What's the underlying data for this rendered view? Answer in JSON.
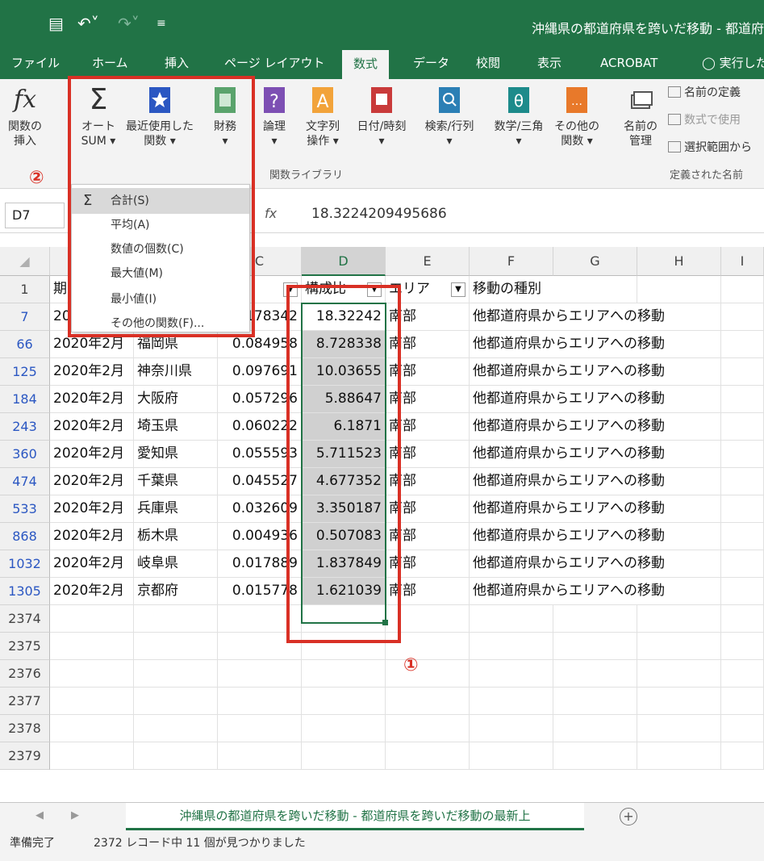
{
  "window": {
    "title": "沖縄県の都道府県を跨いだ移動 - 都道府"
  },
  "tabs": [
    "ファイル",
    "ホーム",
    "挿入",
    "ページ レイアウト",
    "数式",
    "データ",
    "校閲",
    "表示",
    "ACROBAT",
    "実行した"
  ],
  "ribbon": {
    "insert_fn": [
      "関数の",
      "挿入"
    ],
    "autosum": [
      "オート",
      "SUM ▾"
    ],
    "recent": [
      "最近使用した",
      "関数 ▾"
    ],
    "finance": [
      "財務",
      "▾"
    ],
    "logic": [
      "論理",
      "▾"
    ],
    "text": [
      "文字列",
      "操作 ▾"
    ],
    "datetime": [
      "日付/時刻",
      "▾"
    ],
    "lookup": [
      "検索/行列",
      "▾"
    ],
    "math": [
      "数学/三角",
      "▾"
    ],
    "other": [
      "その他の",
      "関数 ▾"
    ],
    "name_mgr": [
      "名前の",
      "管理"
    ],
    "define_name": "名前の定義",
    "use_formula": "数式で使用",
    "from_selection": "選択範囲から",
    "group_library": "関数ライブラリ",
    "group_names": "定義された名前"
  },
  "formula_bar": {
    "cell": "D7",
    "fx": "fx",
    "value": "18.3224209495686"
  },
  "dropdown": {
    "items": [
      "合計(S)",
      "平均(A)",
      "数値の個数(C)",
      "最大値(M)",
      "最小値(I)",
      "その他の関数(F)..."
    ]
  },
  "grid": {
    "columns": [
      "C",
      "D",
      "E",
      "F",
      "G",
      "H",
      "I"
    ],
    "header_row": {
      "num": "1",
      "a": "期",
      "d": "構成比",
      "e": "エリア",
      "f": "移動の種別"
    },
    "rows": [
      {
        "num": "7",
        "a": "20",
        "b": "",
        "c": "178342",
        "d": "18.32242",
        "e": "南部",
        "f": "他都道府県からエリアへの移動"
      },
      {
        "num": "66",
        "a": "2020年2月",
        "b": "福岡県",
        "c": "0.084958",
        "d": "8.728338",
        "e": "南部",
        "f": "他都道府県からエリアへの移動"
      },
      {
        "num": "125",
        "a": "2020年2月",
        "b": "神奈川県",
        "c": "0.097691",
        "d": "10.03655",
        "e": "南部",
        "f": "他都道府県からエリアへの移動"
      },
      {
        "num": "184",
        "a": "2020年2月",
        "b": "大阪府",
        "c": "0.057296",
        "d": "5.88647",
        "e": "南部",
        "f": "他都道府県からエリアへの移動"
      },
      {
        "num": "243",
        "a": "2020年2月",
        "b": "埼玉県",
        "c": "0.060222",
        "d": "6.1871",
        "e": "南部",
        "f": "他都道府県からエリアへの移動"
      },
      {
        "num": "360",
        "a": "2020年2月",
        "b": "愛知県",
        "c": "0.055593",
        "d": "5.711523",
        "e": "南部",
        "f": "他都道府県からエリアへの移動"
      },
      {
        "num": "474",
        "a": "2020年2月",
        "b": "千葉県",
        "c": "0.045527",
        "d": "4.677352",
        "e": "南部",
        "f": "他都道府県からエリアへの移動"
      },
      {
        "num": "533",
        "a": "2020年2月",
        "b": "兵庫県",
        "c": "0.032609",
        "d": "3.350187",
        "e": "南部",
        "f": "他都道府県からエリアへの移動"
      },
      {
        "num": "868",
        "a": "2020年2月",
        "b": "栃木県",
        "c": "0.004936",
        "d": "0.507083",
        "e": "南部",
        "f": "他都道府県からエリアへの移動"
      },
      {
        "num": "1032",
        "a": "2020年2月",
        "b": "岐阜県",
        "c": "0.017889",
        "d": "1.837849",
        "e": "南部",
        "f": "他都道府県からエリアへの移動"
      },
      {
        "num": "1305",
        "a": "2020年2月",
        "b": "京都府",
        "c": "0.015778",
        "d": "1.621039",
        "e": "南部",
        "f": "他都道府県からエリアへの移動"
      }
    ],
    "empty_rows": [
      "2374",
      "2375",
      "2376",
      "2377",
      "2378",
      "2379"
    ]
  },
  "annotations": {
    "one": "①",
    "two": "②"
  },
  "sheet": {
    "name": "沖縄県の都道府県を跨いだ移動 - 都道府県を跨いだ移動の最新上",
    "add": "+"
  },
  "status": {
    "ready": "準備完了",
    "message": "2372 レコード中 11 個が見つかりました"
  }
}
